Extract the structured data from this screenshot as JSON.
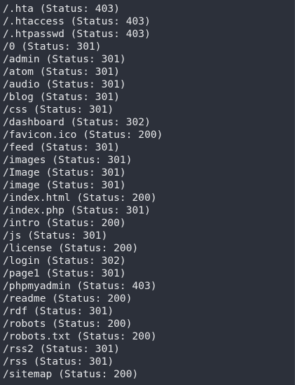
{
  "terminal": {
    "lines": [
      "/.hta (Status: 403)",
      "/.htaccess (Status: 403)",
      "/.htpasswd (Status: 403)",
      "/0 (Status: 301)",
      "/admin (Status: 301)",
      "/atom (Status: 301)",
      "/audio (Status: 301)",
      "/blog (Status: 301)",
      "/css (Status: 301)",
      "/dashboard (Status: 302)",
      "/favicon.ico (Status: 200)",
      "/feed (Status: 301)",
      "/images (Status: 301)",
      "/Image (Status: 301)",
      "/image (Status: 301)",
      "/index.html (Status: 200)",
      "/index.php (Status: 301)",
      "/intro (Status: 200)",
      "/js (Status: 301)",
      "/license (Status: 200)",
      "/login (Status: 302)",
      "/page1 (Status: 301)",
      "/phpmyadmin (Status: 403)",
      "/readme (Status: 200)",
      "/rdf (Status: 301)",
      "/robots (Status: 200)",
      "/robots.txt (Status: 200)",
      "/rss2 (Status: 301)",
      "/rss (Status: 301)",
      "/sitemap (Status: 200)"
    ],
    "colors": {
      "background": "#2c303a",
      "text": "#e7e8ea"
    }
  }
}
